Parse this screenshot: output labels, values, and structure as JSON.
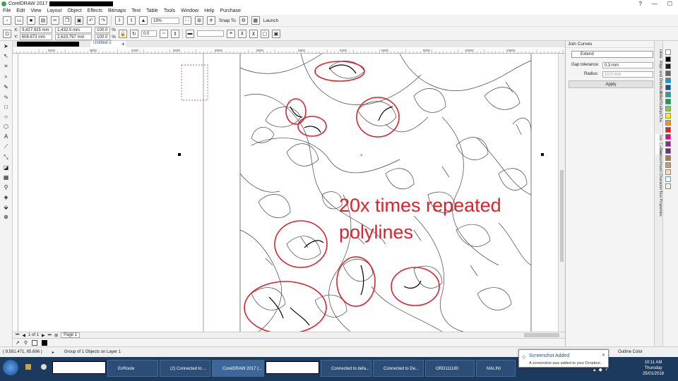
{
  "window": {
    "app_title": "CorelDRAW 2017",
    "controls": [
      "?",
      "—",
      "☐"
    ]
  },
  "menu": [
    "File",
    "Edit",
    "View",
    "Layout",
    "Object",
    "Effects",
    "Bitmaps",
    "Text",
    "Table",
    "Tools",
    "Window",
    "Help",
    "Purchase"
  ],
  "toolbar": {
    "zoom": "19%",
    "snap_to": "Snap To",
    "launch": "Launch"
  },
  "property_bar": {
    "x": "9,427.925 mm",
    "y": "608.873 mm",
    "width": "1,432.0 mm",
    "height": "2,623.797 mm",
    "scale_x": "100.0",
    "scale_y": "100.0",
    "pct": "%",
    "rotation": "0.0"
  },
  "document": {
    "tab_label": "Untitled-2",
    "page_counter": "1 of 1",
    "page_tab": "Page 1"
  },
  "ruler_ticks": [
    "8000",
    "8200",
    "8400",
    "8600",
    "8800",
    "9000",
    "9200",
    "9400",
    "9600",
    "9800",
    "10000",
    "10200"
  ],
  "annotation": {
    "line1": "20x times repeated",
    "line2": "polylines",
    "color": "#d9232d"
  },
  "docker": {
    "title": "Join Curves",
    "mode": "Extend",
    "gap_label": "Gap tolerance:",
    "gap_value": "0.3 mm",
    "radius_label": "Radius:",
    "radius_value": "10.0 mm",
    "apply_label": "Apply"
  },
  "vertical_tabs": [
    "Hints",
    "Align and Distribute",
    "Fillet/Scallop/Cha",
    "Join Curves",
    "Contour",
    "Insert Character",
    "Text Properties"
  ],
  "status": {
    "coords": "( 9,581.471, 65.696 )",
    "info": "Group of 1 Objects on Layer 1",
    "outline": "Outline Color"
  },
  "notification": {
    "title": "Screenshot Added",
    "body": "A screenshot was added to your Dropbox."
  },
  "taskbar": {
    "items": [
      "EnRoute",
      "(2) Connected to ...",
      "CorelDRAW 2017 (...",
      "Connected to defa...",
      "Connected to De...",
      "ORD111180",
      "MALINI"
    ],
    "time": "10:11 AM",
    "day": "Thursday",
    "date": "25/01/2018"
  },
  "palette_colors": [
    "#ffffff",
    "#000000",
    "#1a1a1a",
    "#666666",
    "#00a0e3",
    "#00599d",
    "#21a0a0",
    "#00a651",
    "#8dc63f",
    "#fff200",
    "#f7941d",
    "#ed1c24",
    "#ec008c",
    "#92278f",
    "#662d91",
    "#a67c52",
    "#c69c6d",
    "#ffdab9",
    "#e0ffff",
    "#f5f5dc"
  ]
}
